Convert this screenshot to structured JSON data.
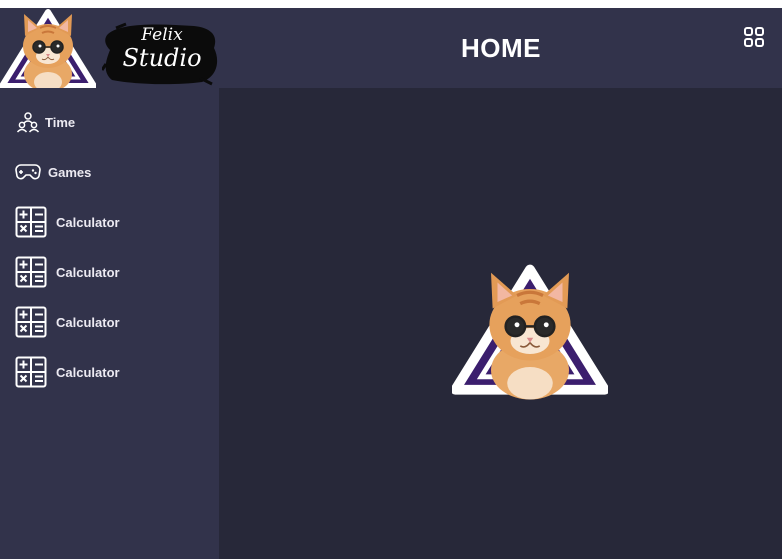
{
  "brand": {
    "line1": "Felix",
    "line2": "Studio",
    "logo_icon": "cat-logo"
  },
  "header": {
    "title": "HOME",
    "apps_icon": "grid-icon"
  },
  "sidebar": {
    "items": [
      {
        "label": "Time",
        "icon": "team-icon"
      },
      {
        "label": "Games",
        "icon": "gamepad-icon"
      },
      {
        "label": "Calculator",
        "icon": "calculator-icon"
      },
      {
        "label": "Calculator",
        "icon": "calculator-icon"
      },
      {
        "label": "Calculator",
        "icon": "calculator-icon"
      },
      {
        "label": "Calculator",
        "icon": "calculator-icon"
      }
    ]
  },
  "main": {
    "hero_icon": "cat-logo"
  },
  "colors": {
    "header_bg": "#32334b",
    "sidebar_bg": "#32334b",
    "content_bg": "#272839",
    "text": "#eceaf2",
    "accent_purple": "#3b1e6e"
  }
}
